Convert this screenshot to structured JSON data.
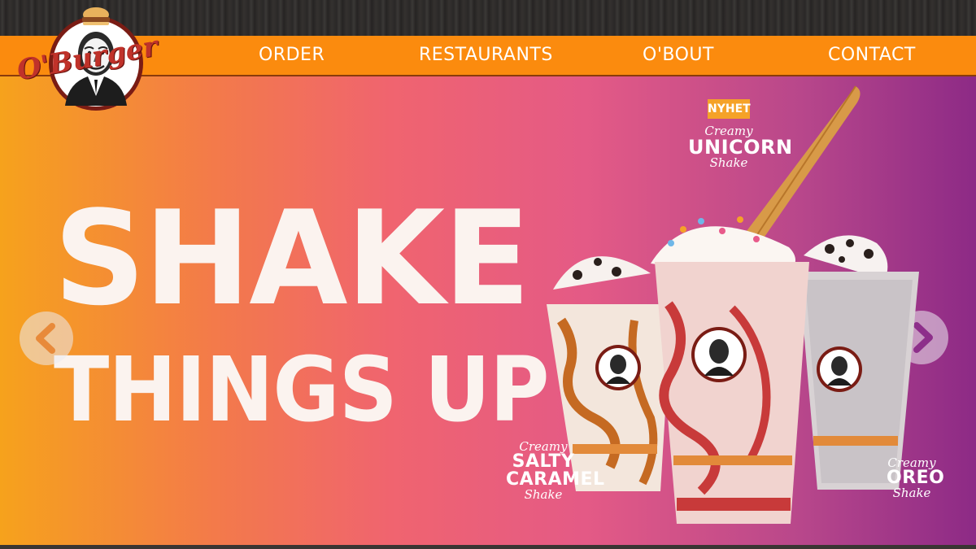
{
  "brand": {
    "name": "O'Burger"
  },
  "nav": {
    "items": [
      {
        "label": "ORDER"
      },
      {
        "label": "RESTAURANTS"
      },
      {
        "label": "O'BOUT"
      },
      {
        "label": "CONTACT"
      }
    ]
  },
  "hero": {
    "headline_line1": "SHAKE",
    "headline_line2": "THINGS UP",
    "badge": "NYHET",
    "products": [
      {
        "prefix": "Creamy",
        "name": "UNICORN",
        "suffix": "Shake"
      },
      {
        "prefix": "Creamy",
        "name_line1": "SALTY",
        "name_line2": "CARAMEL",
        "suffix": "Shake"
      },
      {
        "prefix": "Creamy",
        "name": "OREO",
        "suffix": "Shake"
      }
    ],
    "cup_logo_text": "O'Burger"
  },
  "carousel": {
    "prev_icon": "chevron-left-icon",
    "next_icon": "chevron-right-icon"
  },
  "colors": {
    "nav_bg": "#fb8b0e",
    "hero_gradient_start": "#f6a21c",
    "hero_gradient_mid": "#f0646f",
    "hero_gradient_end": "#8d2a86",
    "headline_text": "#fbf3ef",
    "badge_bg": "#f5a228"
  }
}
